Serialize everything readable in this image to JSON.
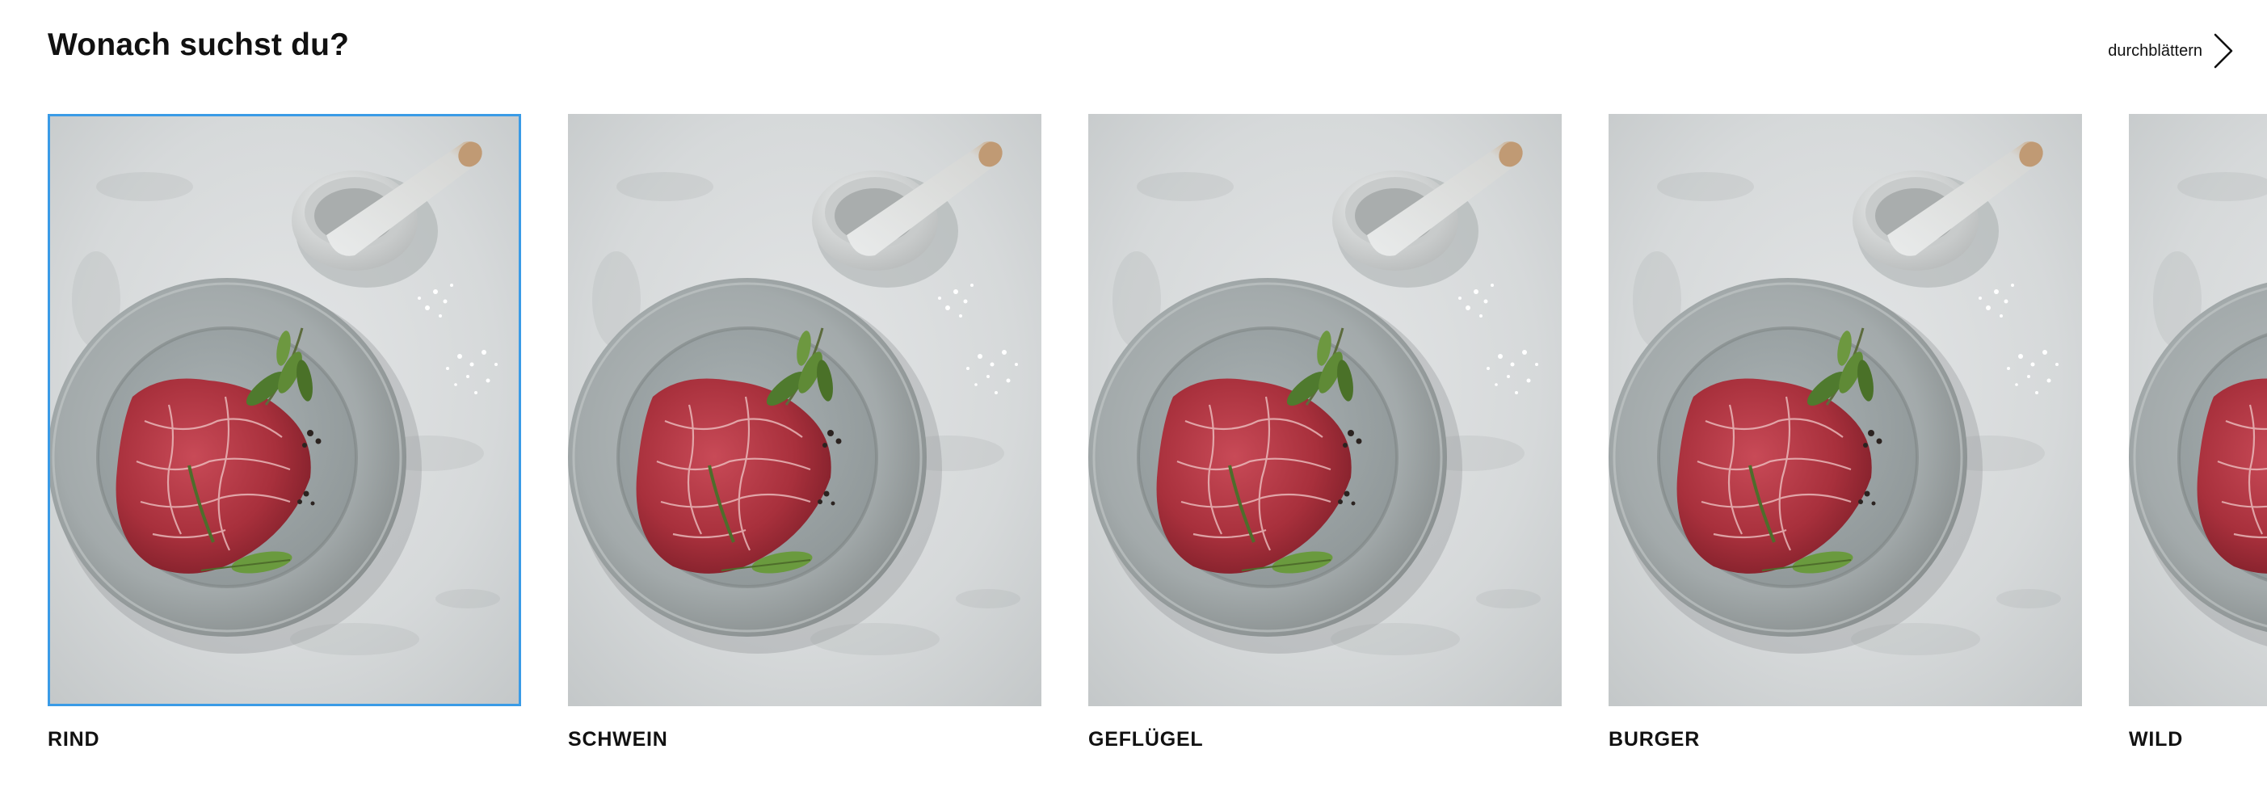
{
  "header": {
    "title": "Wonach suchst du?",
    "browse_label": "durchblättern",
    "browse_icon": "chevron-right-icon"
  },
  "categories": [
    {
      "label": "RIND",
      "selected": true
    },
    {
      "label": "SCHWEIN",
      "selected": false
    },
    {
      "label": "GEFLÜGEL",
      "selected": false
    },
    {
      "label": "BURGER",
      "selected": false
    },
    {
      "label": "WILD",
      "selected": false
    }
  ],
  "colors": {
    "selection_outline": "#3a9be6",
    "text": "#111111",
    "background": "#ffffff"
  }
}
